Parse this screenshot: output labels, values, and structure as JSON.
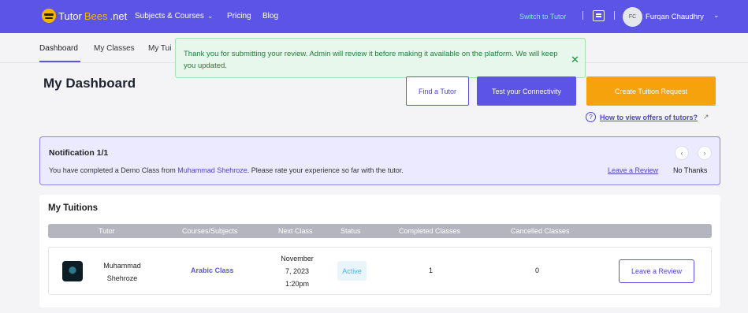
{
  "navbar": {
    "logo_parts": [
      "Tutor",
      "Bees",
      ".net"
    ],
    "subjects_label": "Subjects & Courses",
    "pricing_label": "Pricing",
    "blog_label": "Blog",
    "switch_label": "Switch to Tutor",
    "avatar_initials": "FC",
    "user_name": "Furqan Chaudhry",
    "colors": {
      "bar": "#5b54e6",
      "switch": "#7df0c9"
    }
  },
  "tabs": [
    "Dashboard",
    "My Classes",
    "My Tui"
  ],
  "toast": {
    "message": "Thank you for submitting your review. Admin will review it before making it available on the platform. We will keep you updated.",
    "close_symbol": "✕"
  },
  "page_title": "My Dashboard",
  "actions": {
    "find_tutor": "Find a Tutor",
    "test_connectivity": "Test your Connectivity",
    "create_request": "Create Tuition Request",
    "help_link": "How to view offers of tutors?"
  },
  "notification": {
    "title": "Notification 1/1",
    "message_prefix": "You have completed a Demo Class from ",
    "tutor_name": "Muhammad Shehroze",
    "message_suffix": ". Please rate your experience so far with the tutor.",
    "leave_review": "Leave a Review",
    "no_thanks": "No Thanks"
  },
  "tuitions": {
    "title": "My Tuitions",
    "columns": [
      "Tutor",
      "Courses/Subjects",
      "Next Class",
      "Status",
      "Completed Classes",
      "Cancelled Classes"
    ],
    "rows": [
      {
        "tutor_line1": "Muhammad",
        "tutor_line2": "Shehroze",
        "course": "Arabic Class",
        "next_line1": "November",
        "next_line2": "7, 2023",
        "next_line3": "1:20pm",
        "status": "Active",
        "completed": "1",
        "cancelled": "0",
        "action": "Leave a Review"
      }
    ]
  }
}
